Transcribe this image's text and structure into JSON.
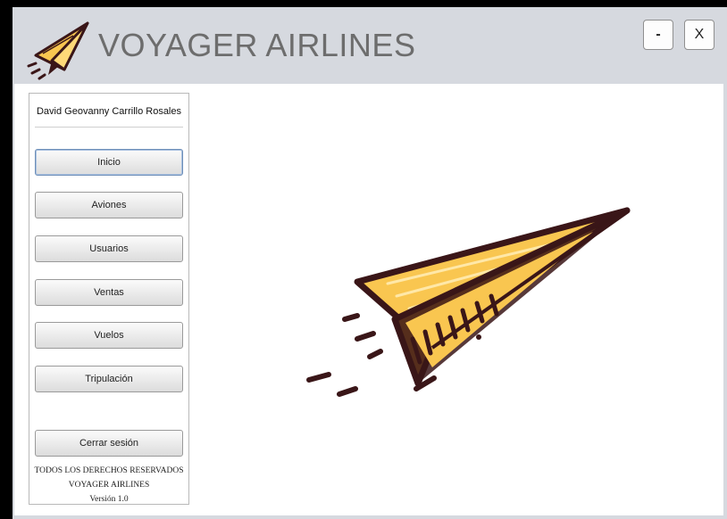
{
  "app": {
    "title": "VOYAGER AIRLINES"
  },
  "window_controls": {
    "minimize": "-",
    "close": "X"
  },
  "sidebar": {
    "user_name": "David Geovanny Carrillo Rosales",
    "items": [
      {
        "label": "Inicio",
        "active": true
      },
      {
        "label": "Aviones"
      },
      {
        "label": "Usuarios"
      },
      {
        "label": "Ventas"
      },
      {
        "label": "Vuelos"
      },
      {
        "label": "Tripulación"
      }
    ],
    "logout_label": "Cerrar sesión",
    "footer": {
      "rights": "TODOS LOS DERECHOS RESERVADOS",
      "company": "VOYAGER AIRLINES",
      "version": "Versión 1.0"
    }
  },
  "colors": {
    "title_text": "#6d6d6d",
    "titlebar_bg": "#d6d9df",
    "plane_yellow": "#f9c650",
    "plane_outline": "#3a1618"
  },
  "icons": {
    "logo": "paper-plane-icon",
    "hero": "paper-plane-illustration"
  }
}
